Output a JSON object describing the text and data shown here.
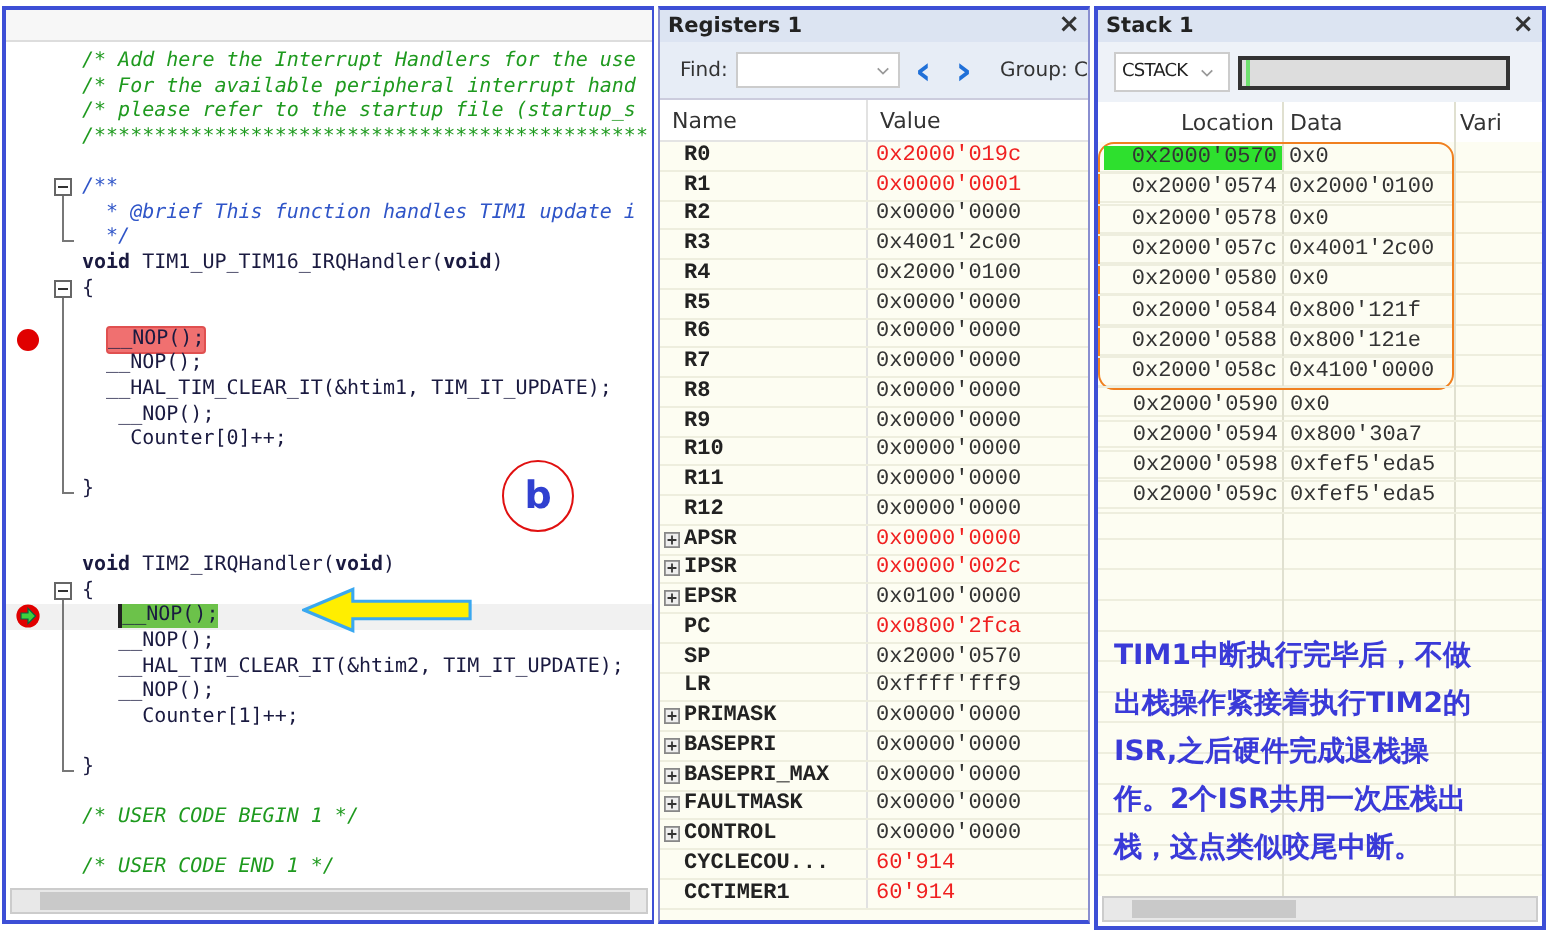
{
  "editor": {
    "annotation_label": "b",
    "lines": [
      {
        "kind": "comment",
        "text": "/* Add here the Interrupt Handlers for the use"
      },
      {
        "kind": "comment",
        "text": "/* For the available peripheral interrupt hand"
      },
      {
        "kind": "comment",
        "text": "/* please refer to the startup file (startup_s"
      },
      {
        "kind": "comment",
        "text": "/**********************************************"
      },
      {
        "kind": "blank"
      },
      {
        "kind": "doc",
        "text": "/**",
        "collapsible": true
      },
      {
        "kind": "doc",
        "text": "  * @brief This function handles TIM1 update i"
      },
      {
        "kind": "doc",
        "text": "  */",
        "block_end": true
      },
      {
        "kind": "code",
        "text": "**void** TIM1_UP_TIM16_IRQHandler(**void**)"
      },
      {
        "kind": "code",
        "text": "{",
        "collapsible": true
      },
      {
        "kind": "blank"
      },
      {
        "kind": "code",
        "text": "  __NOP();",
        "breakpoint": true,
        "current": false
      },
      {
        "kind": "code",
        "text": "  __NOP();"
      },
      {
        "kind": "code",
        "text": "  __HAL_TIM_CLEAR_IT(&htim1, TIM_IT_UPDATE);"
      },
      {
        "kind": "code",
        "text": "   __NOP();"
      },
      {
        "kind": "code",
        "text": "    Counter[0]++;"
      },
      {
        "kind": "blank"
      },
      {
        "kind": "code",
        "text": "}",
        "block_end": true
      },
      {
        "kind": "blank"
      },
      {
        "kind": "blank"
      },
      {
        "kind": "code",
        "text": "**void** TIM2_IRQHandler(**void**)"
      },
      {
        "kind": "code",
        "text": "{",
        "collapsible": true
      },
      {
        "kind": "code",
        "text": "   __NOP();",
        "breakpoint": false,
        "current": true
      },
      {
        "kind": "code",
        "text": "   __NOP();"
      },
      {
        "kind": "code",
        "text": "   __HAL_TIM_CLEAR_IT(&htim2, TIM_IT_UPDATE);"
      },
      {
        "kind": "code",
        "text": "   __NOP();"
      },
      {
        "kind": "code",
        "text": "     Counter[1]++;"
      },
      {
        "kind": "blank"
      },
      {
        "kind": "code",
        "text": "}",
        "block_end": true
      },
      {
        "kind": "blank"
      },
      {
        "kind": "comment",
        "text": "/* USER CODE BEGIN 1 */"
      },
      {
        "kind": "blank"
      },
      {
        "kind": "comment",
        "text": "/* USER CODE END 1 */"
      }
    ]
  },
  "registers": {
    "title": "Registers 1",
    "close": "×",
    "find_label": "Find:",
    "prev": "‹",
    "next": "›",
    "group_label": "Group: C",
    "columns": [
      "Name",
      "Value"
    ],
    "rows": [
      {
        "name": "R0",
        "value": "0x2000'019c",
        "expandable": false,
        "changed": true
      },
      {
        "name": "R1",
        "value": "0x0000'0001",
        "expandable": false,
        "changed": true
      },
      {
        "name": "R2",
        "value": "0x0000'0000",
        "expandable": false,
        "changed": false
      },
      {
        "name": "R3",
        "value": "0x4001'2c00",
        "expandable": false,
        "changed": false
      },
      {
        "name": "R4",
        "value": "0x2000'0100",
        "expandable": false,
        "changed": false
      },
      {
        "name": "R5",
        "value": "0x0000'0000",
        "expandable": false,
        "changed": false
      },
      {
        "name": "R6",
        "value": "0x0000'0000",
        "expandable": false,
        "changed": false
      },
      {
        "name": "R7",
        "value": "0x0000'0000",
        "expandable": false,
        "changed": false
      },
      {
        "name": "R8",
        "value": "0x0000'0000",
        "expandable": false,
        "changed": false
      },
      {
        "name": "R9",
        "value": "0x0000'0000",
        "expandable": false,
        "changed": false
      },
      {
        "name": "R10",
        "value": "0x0000'0000",
        "expandable": false,
        "changed": false
      },
      {
        "name": "R11",
        "value": "0x0000'0000",
        "expandable": false,
        "changed": false
      },
      {
        "name": "R12",
        "value": "0x0000'0000",
        "expandable": false,
        "changed": false
      },
      {
        "name": "APSR",
        "value": "0x0000'0000",
        "expandable": true,
        "changed": true
      },
      {
        "name": "IPSR",
        "value": "0x0000'002c",
        "expandable": true,
        "changed": true
      },
      {
        "name": "EPSR",
        "value": "0x0100'0000",
        "expandable": true,
        "changed": false
      },
      {
        "name": "PC",
        "value": "0x0800'2fca",
        "expandable": false,
        "changed": true
      },
      {
        "name": "SP",
        "value": "0x2000'0570",
        "expandable": false,
        "changed": false
      },
      {
        "name": "LR",
        "value": "0xffff'fff9",
        "expandable": false,
        "changed": false
      },
      {
        "name": "PRIMASK",
        "value": "0x0000'0000",
        "expandable": true,
        "changed": false
      },
      {
        "name": "BASEPRI",
        "value": "0x0000'0000",
        "expandable": true,
        "changed": false
      },
      {
        "name": "BASEPRI_MAX",
        "value": "0x0000'0000",
        "expandable": true,
        "changed": false
      },
      {
        "name": "FAULTMASK",
        "value": "0x0000'0000",
        "expandable": true,
        "changed": false
      },
      {
        "name": "CONTROL",
        "value": "0x0000'0000",
        "expandable": true,
        "changed": false
      },
      {
        "name": "CYCLECOU...",
        "value": "60'914",
        "expandable": false,
        "changed": true
      },
      {
        "name": "CCTIMER1",
        "value": "60'914",
        "expandable": false,
        "changed": true
      }
    ]
  },
  "stack": {
    "title": "Stack 1",
    "close": "×",
    "stack_select": "CSTACK",
    "usage": {
      "level": 0.03
    },
    "columns": [
      "Location",
      "Data",
      "Vari"
    ],
    "outlined_rows": [
      {
        "location": "0x2000'0570",
        "data": "0x0",
        "selected": true
      },
      {
        "location": "0x2000'0574",
        "data": "0x2000'0100",
        "selected": false
      },
      {
        "location": "0x2000'0578",
        "data": "0x0",
        "selected": false
      },
      {
        "location": "0x2000'057c",
        "data": "0x4001'2c00",
        "selected": false
      },
      {
        "location": "0x2000'0580",
        "data": "0x0",
        "selected": false
      },
      {
        "location": "0x2000'0584",
        "data": "0x800'121f",
        "selected": false
      },
      {
        "location": "0x2000'0588",
        "data": "0x800'121e",
        "selected": false
      },
      {
        "location": "0x2000'058c",
        "data": "0x4100'0000",
        "selected": false
      }
    ],
    "rows": [
      {
        "location": "0x2000'0590",
        "data": "0x0",
        "selected": false
      },
      {
        "location": "0x2000'0594",
        "data": "0x800'30a7",
        "selected": false
      },
      {
        "location": "0x2000'0598",
        "data": "0xfef5'eda5",
        "selected": false
      },
      {
        "location": "0x2000'059c",
        "data": "0xfef5'eda5",
        "selected": false
      }
    ],
    "note": "TIM1中断执行完毕后，不做出栈操作紧接着执行TIM2的ISR,之后硬件完成退栈操作。2个ISR共用一次压栈出栈，这点类似咬尾中断。"
  }
}
